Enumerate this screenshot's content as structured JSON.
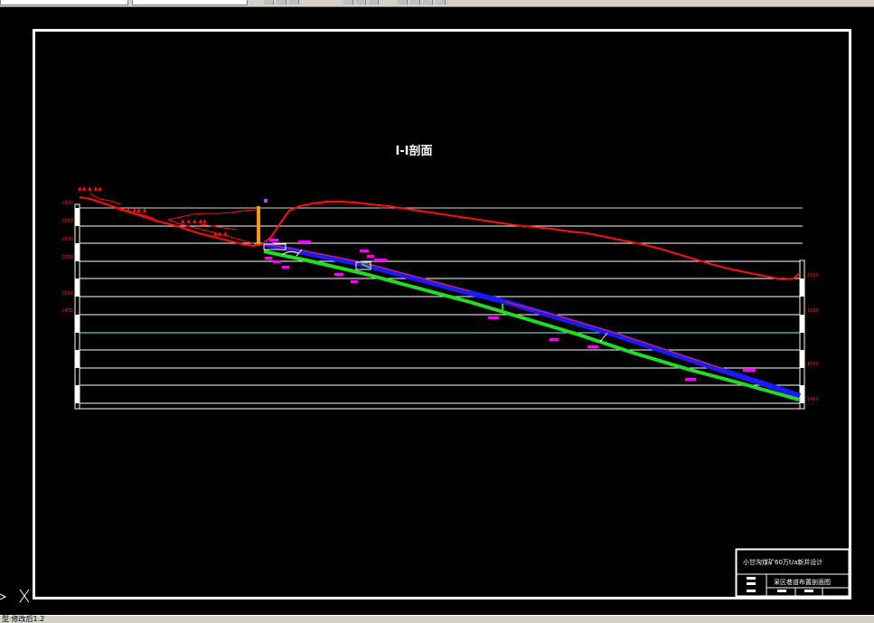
{
  "drawing": {
    "title": "I-I剖面",
    "elevation_labels": [
      "1600",
      "1550",
      "1600",
      "1550",
      "1500",
      "1450",
      "1600",
      "1550",
      "1500",
      "1450"
    ],
    "title_block": {
      "project": "小甘沟煤矿60万t/a新井设计",
      "drawing_name": "采区巷道布置剖面图"
    }
  },
  "statusbar": {
    "command_text": "型  修改后1.2"
  },
  "colors": {
    "background": "#000000",
    "frame": "#ffffff",
    "terrain": "#ff0000",
    "roadway_blue": "#1a1aff",
    "roadway_green": "#22dd22",
    "marker": "#ff00ff",
    "shaft": "#ff9900"
  },
  "icons": [
    "ucs-axis-icon"
  ]
}
